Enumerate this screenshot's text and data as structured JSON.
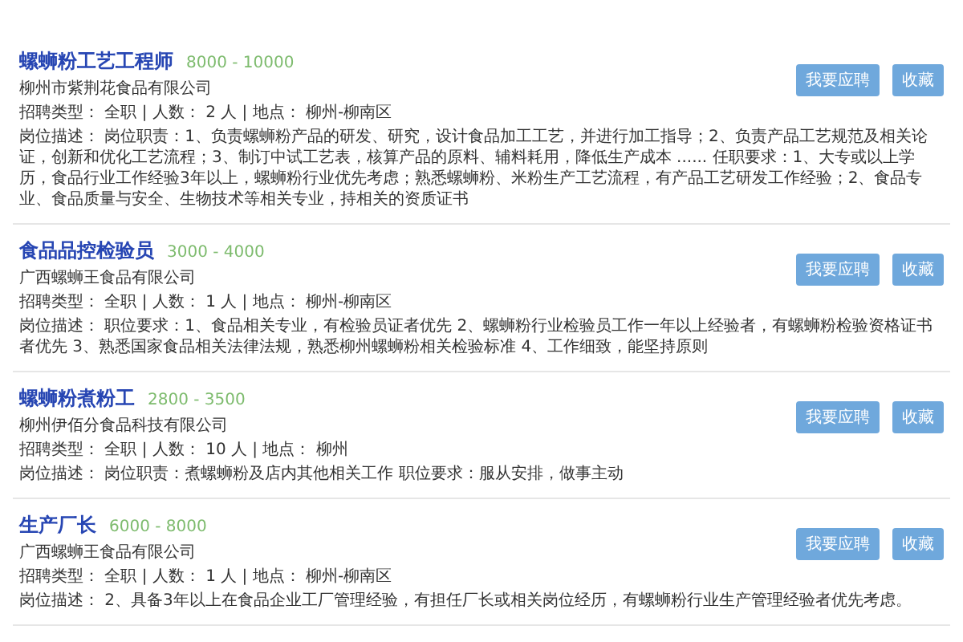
{
  "jobs": [
    {
      "title": "螺蛳粉工艺工程师",
      "salary": "8000 - 10000",
      "company": "柳州市紫荆花食品有限公司",
      "meta": "招聘类型： 全职 | 人数： 2 人 | 地点： 柳州-柳南区",
      "description": "岗位描述： 岗位职责：1、负责螺蛳粉产品的研发、研究，设计食品加工工艺，并进行加工指导；2、负责产品工艺规范及相关论证，创新和优化工艺流程；3、制订中试工艺表，核算产品的原料、辅料耗用，降低生产成本 ...... 任职要求：1、大专或以上学历，食品行业工作经验3年以上，螺蛳粉行业优先考虑；熟悉螺蛳粉、米粉生产工艺流程，有产品工艺研发工作经验；2、食品专业、食品质量与安全、生物技术等相关专业，持相关的资质证书",
      "buttons": [
        "我要应聘",
        "收藏"
      ]
    },
    {
      "title": "食品品控检验员",
      "salary": "3000 - 4000",
      "company": "广西螺蛳王食品有限公司",
      "meta": "招聘类型： 全职 | 人数： 1 人 | 地点： 柳州-柳南区",
      "description": "岗位描述： 职位要求：1、食品相关专业，有检验员证者优先 2、螺蛳粉行业检验员工作一年以上经验者，有螺蛳粉检验资格证书者优先 3、熟悉国家食品相关法律法规，熟悉柳州螺蛳粉相关检验标准 4、工作细致，能坚持原则",
      "buttons": [
        "我要应聘",
        "收藏"
      ]
    },
    {
      "title": "螺蛳粉煮粉工",
      "salary": "2800 - 3500",
      "company": "柳州伊佰分食品科技有限公司",
      "meta": "招聘类型： 全职 | 人数： 10 人 | 地点： 柳州",
      "description": "岗位描述： 岗位职责：煮螺蛳粉及店内其他相关工作 职位要求：服从安排，做事主动",
      "buttons": [
        "我要应聘",
        "收藏"
      ]
    },
    {
      "title": "生产厂长",
      "salary": "6000 - 8000",
      "company": "广西螺蛳王食品有限公司",
      "meta": "招聘类型： 全职 | 人数： 1 人 | 地点： 柳州-柳南区",
      "description": "岗位描述： 2、具备3年以上在食品企业工厂管理经验，有担任厂长或相关岗位经历，有螺蛳粉行业生产管理经验者优先考虑。",
      "buttons": [
        "我要应聘",
        "收藏"
      ]
    }
  ]
}
